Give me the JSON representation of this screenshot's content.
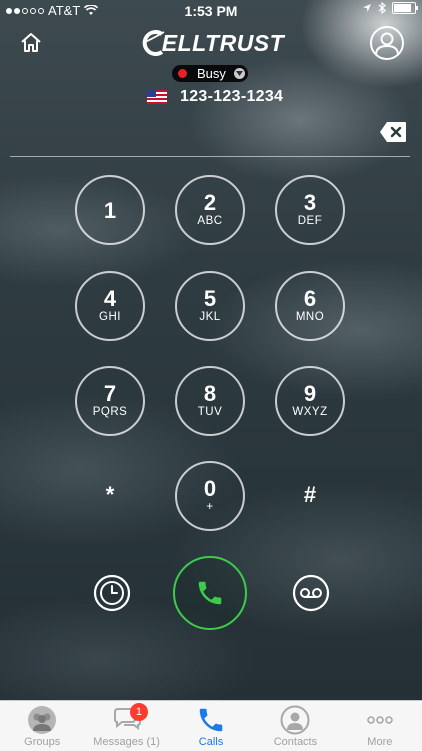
{
  "status_bar": {
    "carrier": "AT&T",
    "time": "1:53 PM"
  },
  "header": {
    "logo_text": "ELLTRUST",
    "status_label": "Busy",
    "status_color": "#e8202a",
    "caller_number": "123-123-1234",
    "flag": "us-flag"
  },
  "keypad": {
    "keys": [
      {
        "num": "1",
        "letters": ""
      },
      {
        "num": "2",
        "letters": "ABC"
      },
      {
        "num": "3",
        "letters": "DEF"
      },
      {
        "num": "4",
        "letters": "GHI"
      },
      {
        "num": "5",
        "letters": "JKL"
      },
      {
        "num": "6",
        "letters": "MNO"
      },
      {
        "num": "7",
        "letters": "PQRS"
      },
      {
        "num": "8",
        "letters": "TUV"
      },
      {
        "num": "9",
        "letters": "WXYZ"
      },
      {
        "num": "*",
        "letters": ""
      },
      {
        "num": "0",
        "letters": "+"
      },
      {
        "num": "#",
        "letters": ""
      }
    ]
  },
  "actions": {
    "call_color": "#3dcc4a",
    "history_icon": "clock-icon",
    "voicemail_icon": "voicemail-icon",
    "call_icon": "phone-icon"
  },
  "tab_bar": {
    "active_color": "#1a7bea",
    "tabs": [
      {
        "label": "Groups",
        "icon": "groups-icon"
      },
      {
        "label": "Messages (1)",
        "icon": "messages-icon",
        "badge": "1"
      },
      {
        "label": "Calls",
        "icon": "phone-icon"
      },
      {
        "label": "Contacts",
        "icon": "contact-icon"
      },
      {
        "label": "More",
        "icon": "more-icon"
      }
    ]
  }
}
